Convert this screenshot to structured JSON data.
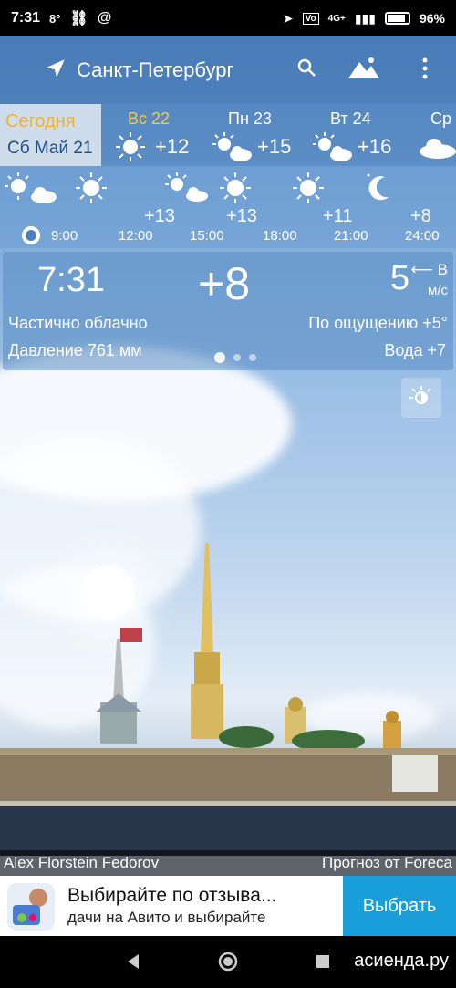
{
  "status": {
    "time": "7:31",
    "notif": "8°",
    "network": "4G+",
    "battery": "96%"
  },
  "header": {
    "city": "Санкт-Петербург"
  },
  "days": {
    "today_label": "Сегодня",
    "today_date": "Сб Май 21",
    "items": [
      {
        "label": "Вс 22",
        "temp": "+12",
        "icon": "sun-icon"
      },
      {
        "label": "Пн 23",
        "temp": "+15",
        "icon": "sun-cloud-icon"
      },
      {
        "label": "Вт 24",
        "temp": "+16",
        "icon": "sun-cloud-icon"
      },
      {
        "label": "Ср",
        "temp": "",
        "icon": "cloud-icon"
      }
    ]
  },
  "hourly": {
    "temps": [
      "+13",
      "+13",
      "+11",
      "+8"
    ],
    "times": [
      "9:00",
      "12:00",
      "15:00",
      "18:00",
      "21:00",
      "24:00"
    ]
  },
  "current": {
    "time": "7:31",
    "temp": "+8",
    "wind_speed": "5",
    "wind_dir": "В",
    "wind_unit": "м/с",
    "condition": "Частично облачно",
    "pressure": "Давление 761 мм",
    "feels_like": "По ощущению +5°",
    "water": "Вода +7"
  },
  "credits": {
    "photo": "Alex Florstein Fedorov",
    "source": "Прогноз от Foreca"
  },
  "ad": {
    "title": "Выбирайте по отзыва...",
    "subtitle": "дачи на Авито и выбирайте",
    "button": "Выбрать"
  },
  "watermark": "асиенда.ру"
}
